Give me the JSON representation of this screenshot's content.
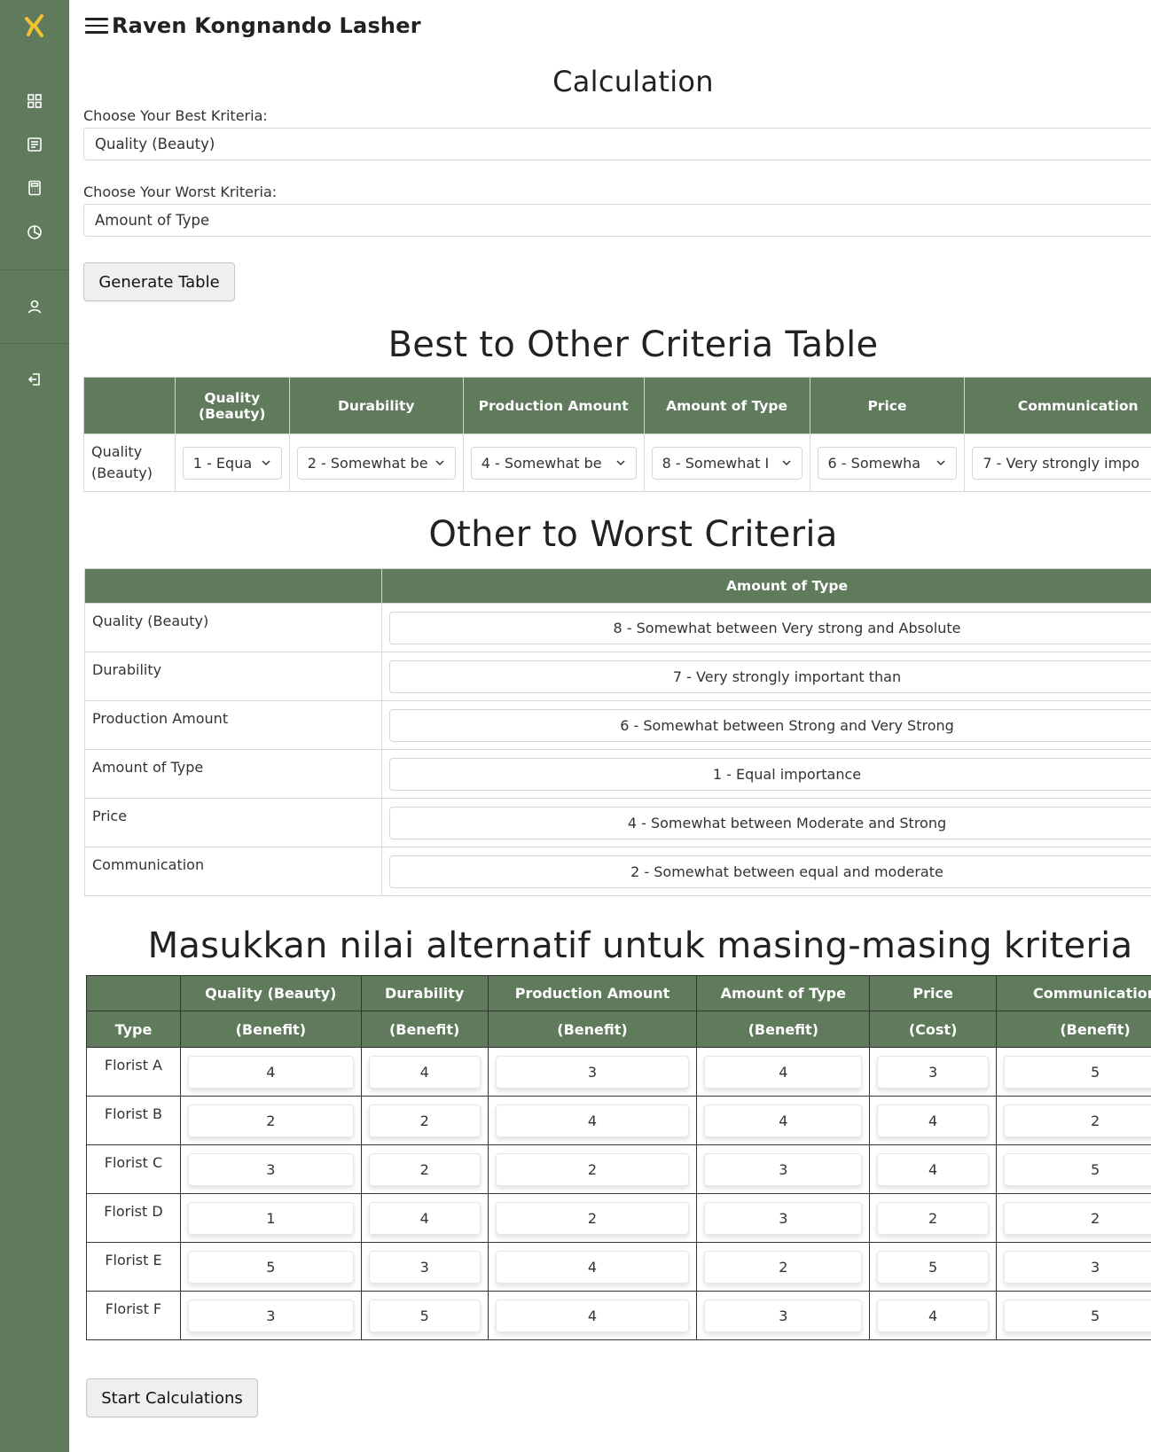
{
  "app": {
    "title": "Raven Kongnando Lasher"
  },
  "sidebar": {
    "icons": [
      "logo-icon",
      "grid-icon",
      "document-icon",
      "calculator-icon",
      "pie-chart-icon",
      "user-icon",
      "logout-icon"
    ]
  },
  "calculation": {
    "title": "Calculation",
    "best_label": "Choose Your Best Kriteria:",
    "best_value": "Quality (Beauty)",
    "worst_label": "Choose Your Worst Kriteria:",
    "worst_value": "Amount of Type",
    "generate_button": "Generate Table"
  },
  "best_table": {
    "title": "Best to Other Criteria Table",
    "headers": [
      "",
      "Quality (Beauty)",
      "Durability",
      "Production Amount",
      "Amount of Type",
      "Price",
      "Communication"
    ],
    "row_label": "Quality (Beauty)",
    "values": [
      "1 - Equa",
      "2 - Somewhat be",
      "4 - Somewhat be",
      "8 - Somewhat I",
      "6 - Somewha",
      "7 - Very strongly impo"
    ]
  },
  "worst_table": {
    "title": "Other to Worst Criteria",
    "header_empty": "",
    "header": "Amount of Type",
    "rows": [
      {
        "label": "Quality (Beauty)",
        "value": "8 - Somewhat between Very strong and Absolute"
      },
      {
        "label": "Durability",
        "value": "7 - Very strongly important than"
      },
      {
        "label": "Production Amount",
        "value": "6 - Somewhat between Strong and Very Strong"
      },
      {
        "label": "Amount of Type",
        "value": "1 - Equal importance"
      },
      {
        "label": "Price",
        "value": "4 - Somewhat between Moderate and Strong"
      },
      {
        "label": "Communication",
        "value": "2 - Somewhat between equal and moderate"
      }
    ]
  },
  "alt_table": {
    "title": "Masukkan nilai alternatif untuk masing-masing kriteria",
    "type_header": "Type",
    "criteria": [
      "Quality (Beauty)",
      "Durability",
      "Production Amount",
      "Amount of Type",
      "Price",
      "Communication"
    ],
    "kinds": [
      "(Benefit)",
      "(Benefit)",
      "(Benefit)",
      "(Benefit)",
      "(Cost)",
      "(Benefit)"
    ],
    "rows": [
      {
        "name": "Florist A",
        "values": [
          "4",
          "4",
          "3",
          "4",
          "3",
          "5"
        ]
      },
      {
        "name": "Florist B",
        "values": [
          "2",
          "2",
          "4",
          "4",
          "4",
          "2"
        ]
      },
      {
        "name": "Florist C",
        "values": [
          "3",
          "2",
          "2",
          "3",
          "4",
          "5"
        ]
      },
      {
        "name": "Florist D",
        "values": [
          "1",
          "4",
          "2",
          "3",
          "2",
          "2"
        ]
      },
      {
        "name": "Florist E",
        "values": [
          "5",
          "3",
          "4",
          "2",
          "5",
          "3"
        ]
      },
      {
        "name": "Florist F",
        "values": [
          "3",
          "5",
          "4",
          "3",
          "4",
          "5"
        ]
      }
    ]
  },
  "start_button": "Start Calculations",
  "colors": {
    "sidebar": "#5f7b5c",
    "header_bg": "#5f7b5c",
    "logo": "#f2c230"
  }
}
